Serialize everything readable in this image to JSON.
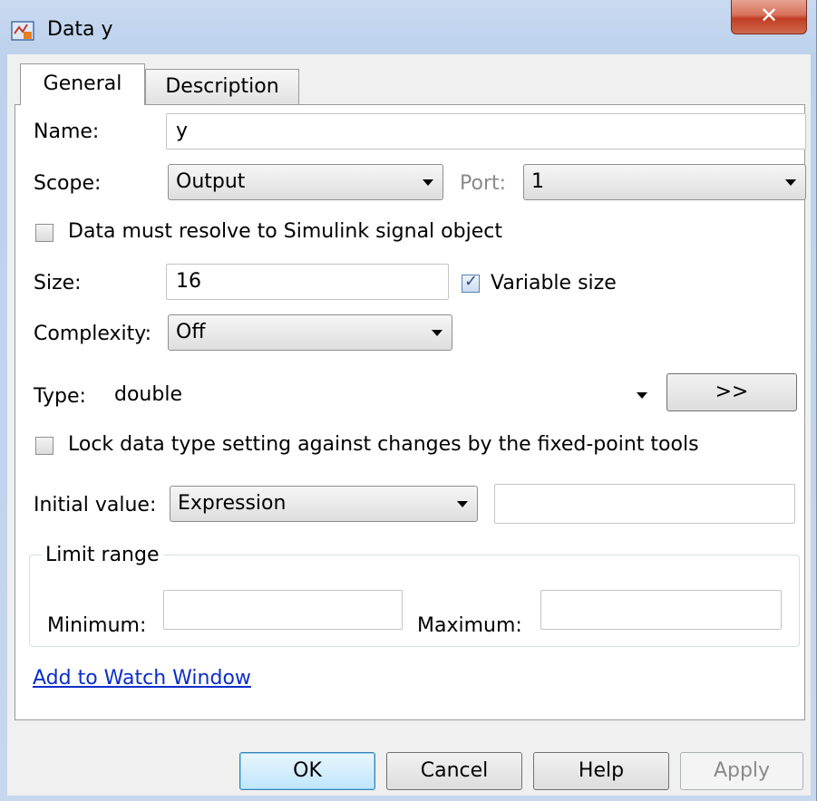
{
  "window": {
    "title": "Data y"
  },
  "tabs": [
    {
      "label": "General"
    },
    {
      "label": "Description"
    }
  ],
  "form": {
    "name": {
      "label": "Name:",
      "value": "y"
    },
    "scope": {
      "label": "Scope:",
      "value": "Output"
    },
    "port": {
      "label": "Port:",
      "value": "1"
    },
    "resolve_signal": {
      "label": "Data must resolve to Simulink signal object",
      "checked": false
    },
    "size": {
      "label": "Size:",
      "value": "16"
    },
    "variable_size": {
      "label": "Variable size",
      "checked": true
    },
    "complexity": {
      "label": "Complexity:",
      "value": "Off"
    },
    "type": {
      "label": "Type:",
      "value": "double",
      "assistant_label": ">>"
    },
    "lock_type": {
      "label": "Lock data type setting against changes by the fixed-point tools",
      "checked": false
    },
    "initial_value": {
      "label": "Initial value:",
      "mode": "Expression",
      "value": ""
    },
    "limit_range": {
      "title": "Limit range",
      "minimum_label": "Minimum:",
      "minimum_value": "",
      "maximum_label": "Maximum:",
      "maximum_value": ""
    },
    "watch_link": "Add to Watch Window"
  },
  "buttons": {
    "ok": "OK",
    "cancel": "Cancel",
    "help": "Help",
    "apply": "Apply"
  },
  "colors": {
    "close_button": "#c13d22",
    "link": "#0b2ec8",
    "default_button_border": "#3c7fb1"
  }
}
